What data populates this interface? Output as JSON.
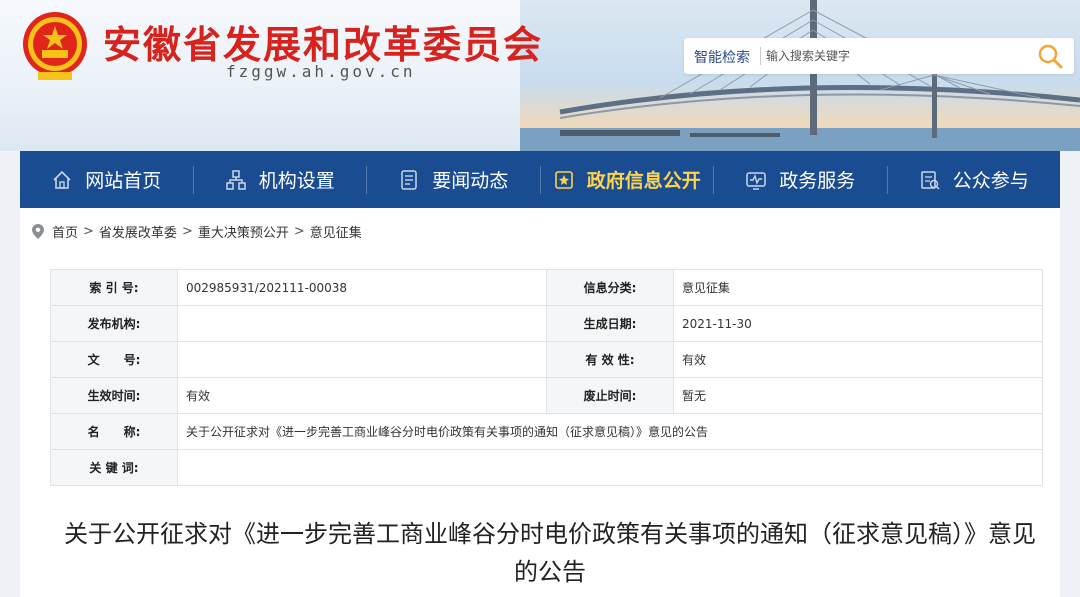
{
  "site": {
    "name": "安徽省发展和改革委员会",
    "url": "fzggw.ah.gov.cn"
  },
  "search": {
    "label": "智能检索",
    "placeholder": "输入搜索关键字"
  },
  "nav": [
    {
      "label": "网站首页",
      "icon": "home-icon"
    },
    {
      "label": "机构设置",
      "icon": "org-icon"
    },
    {
      "label": "要闻动态",
      "icon": "news-icon"
    },
    {
      "label": "政府信息公开",
      "icon": "info-open-icon",
      "active": true
    },
    {
      "label": "政务服务",
      "icon": "service-icon"
    },
    {
      "label": "公众参与",
      "icon": "participate-icon"
    }
  ],
  "breadcrumb": [
    "首页",
    "省发展改革委",
    "重大决策预公开",
    "意见征集"
  ],
  "meta": {
    "index_label": "索 引 号:",
    "index_value": "002985931/202111-00038",
    "category_label": "信息分类:",
    "category_value": "意见征集",
    "publisher_label": "发布机构:",
    "publisher_value": "",
    "date_label": "生成日期:",
    "date_value": "2021-11-30",
    "docno_label": "文　　号:",
    "docno_value": "",
    "validity_label": "有 效 性:",
    "validity_value": "有效",
    "effective_label": "生效时间:",
    "effective_value": "有效",
    "expire_label": "废止时间:",
    "expire_value": "暂无",
    "name_label": "名　　称:",
    "name_value": "关于公开征求对《进一步完善工商业峰谷分时电价政策有关事项的通知（征求意见稿）》意见的公告",
    "keywords_label": "关 键 词:",
    "keywords_value": ""
  },
  "article": {
    "title": "关于公开征求对《进一步完善工商业峰谷分时电价政策有关事项的通知（征求意见稿）》意见的公告"
  },
  "colors": {
    "brand_red": "#d7221d",
    "nav_blue": "#1a4c91",
    "nav_active": "#ffd44a"
  }
}
